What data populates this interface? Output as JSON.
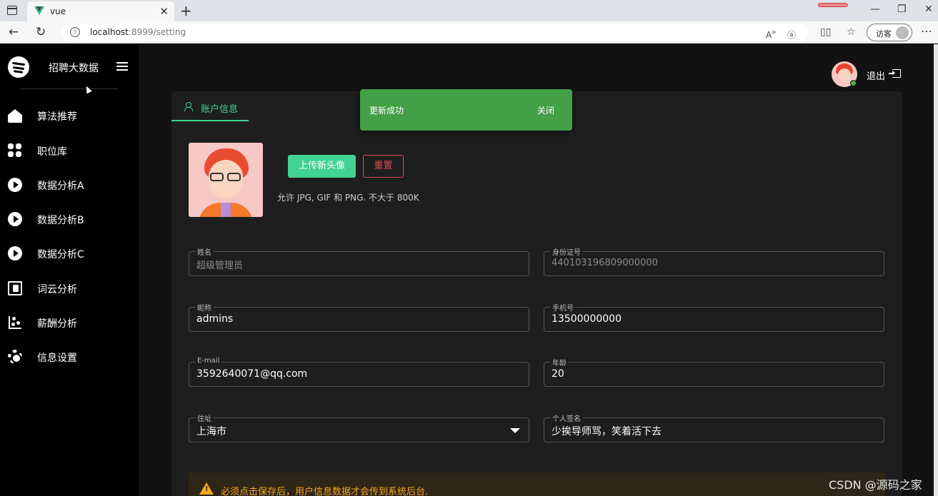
{
  "browser": {
    "tab_title": "vue",
    "url_host": "localhost",
    "url_path": ":8999/setting",
    "guest_label": "访客",
    "icons": [
      "window-icon",
      "vue-favicon",
      "close-icon",
      "plus-icon",
      "back-icon",
      "reload-icon",
      "info-icon",
      "read-aloud-icon",
      "translate-icon",
      "split-screen-icon",
      "favorites-icon",
      "more-icon"
    ]
  },
  "sidebar": {
    "brand": "招聘大数据",
    "items": [
      {
        "label": "算法推荐",
        "icon": "home-icon"
      },
      {
        "label": "职位库",
        "icon": "grid-icon"
      },
      {
        "label": "数据分析A",
        "icon": "play-circle-icon"
      },
      {
        "label": "数据分析B",
        "icon": "play-circle-icon"
      },
      {
        "label": "数据分析C",
        "icon": "play-circle-icon"
      },
      {
        "label": "词云分析",
        "icon": "library-music-icon"
      },
      {
        "label": "薪酬分析",
        "icon": "scatter-chart-icon"
      },
      {
        "label": "信息设置",
        "icon": "gear-icon"
      }
    ]
  },
  "header": {
    "logout_label": "退出"
  },
  "account": {
    "tab_label": "账户信息",
    "upload_label": "上传新头像",
    "reset_label": "重置",
    "hint": "允许 JPG, GIF 和 PNG. 不大于 800K",
    "fields": {
      "name": {
        "label": "姓名",
        "value": "超级管理员"
      },
      "id_number": {
        "label": "身份证号",
        "value": "440103196809000000"
      },
      "nickname": {
        "label": "昵称",
        "value": "admins"
      },
      "phone": {
        "label": "手机号",
        "value": "13500000000"
      },
      "email": {
        "label": "E-mail",
        "value": "3592640071@qq.com"
      },
      "age": {
        "label": "年龄",
        "value": "20"
      },
      "address": {
        "label": "住址",
        "value": "上海市"
      },
      "signature": {
        "label": "个人签名",
        "value": "少挨导师骂，笑着活下去"
      }
    },
    "warning": "必须点击保存后，用户信息数据才会传到系统后台."
  },
  "toast": {
    "message": "更新成功",
    "close_label": "关闭"
  },
  "watermark": "CSDN @源码之家",
  "colors": {
    "accent": "#42d392",
    "danger": "#e04b55",
    "success_toast": "#43a047",
    "warning": "#f5a623"
  }
}
